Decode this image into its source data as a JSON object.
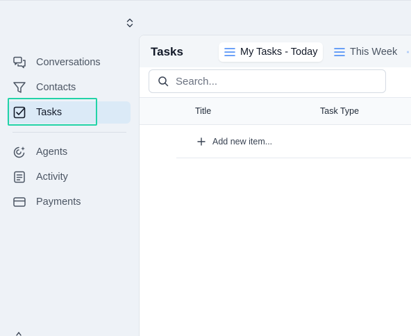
{
  "sidebar": {
    "items": [
      {
        "label": "Conversations",
        "icon": "conversations-icon"
      },
      {
        "label": "Contacts",
        "icon": "filter-icon"
      },
      {
        "label": "Tasks",
        "icon": "checkbox-icon"
      },
      {
        "label": "Agents",
        "icon": "agents-icon"
      },
      {
        "label": "Activity",
        "icon": "activity-icon"
      },
      {
        "label": "Payments",
        "icon": "credit-card-icon"
      }
    ],
    "active": "Tasks"
  },
  "main": {
    "title": "Tasks",
    "views": [
      {
        "label": "My Tasks - Today",
        "selected": true
      },
      {
        "label": "This Week",
        "selected": false
      }
    ],
    "search": {
      "placeholder": "Search...",
      "value": ""
    },
    "table": {
      "columns": [
        "Title",
        "Task Type"
      ],
      "add_row_label": "Add new item..."
    }
  },
  "colors": {
    "accent_blue": "#3b82f6",
    "active_bg": "#dbeaf7",
    "focus_ring": "#22d3a7"
  }
}
